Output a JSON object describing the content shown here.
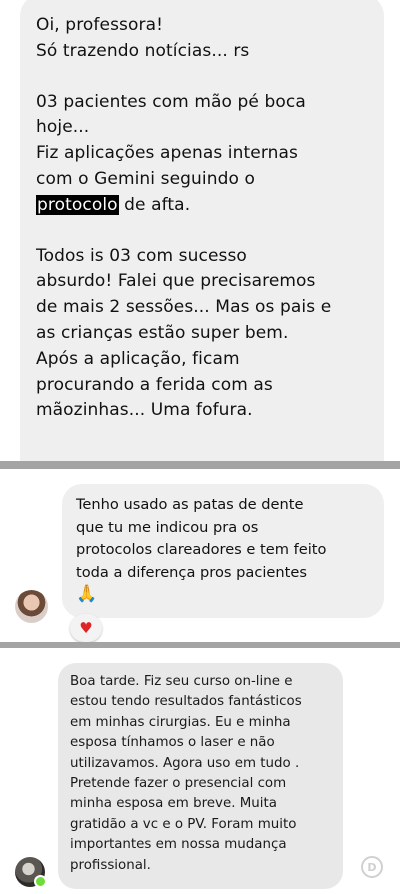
{
  "message_1": {
    "paragraph_1": [
      "Oi, professora!",
      "Só trazendo notícias... rs"
    ],
    "paragraph_2": {
      "lines": [
        "03 pacientes com mão pé boca",
        "hoje...",
        "Fiz aplicações apenas internas",
        "com o Gemini seguindo o"
      ],
      "highlighted_word": "protocolo",
      "after_highlight": " de afta."
    },
    "paragraph_3": [
      "Todos is 03 com sucesso",
      "absurdo! Falei que precisaremos",
      "de mais 2 sessões... Mas os pais e",
      "as crianças estão super bem.",
      "Após a aplicação, ficam",
      "procurando a ferida com as",
      "mãozinhas... Uma fofura."
    ]
  },
  "message_2": {
    "lines": [
      "Tenho usado as patas de dente",
      "que tu me indicou pra os",
      "protocolos clareadores e tem feito",
      "toda a diferença pros pacientes"
    ],
    "emoji": "🙏",
    "reaction": "♥",
    "avatar_icon": "woman-avatar-icon"
  },
  "message_3": {
    "lines": [
      "Boa tarde. Fiz seu curso on-line e",
      "estou tendo resultados fantásticos",
      "em minhas cirurgias. Eu e minha",
      "esposa tínhamos o laser e não",
      "utilizavamos. Agora uso em tudo .",
      "Pretende fazer o presencial com",
      "minha esposa em breve. Muita",
      "gratidão a vc e o PV. Foram muito",
      "importantes em nossa mudança",
      "profissional."
    ],
    "avatar_icon": "man-avatar-icon",
    "status_color": "#6fdc3a",
    "watermark_letter": "D"
  },
  "colors": {
    "bubble": "#efefef",
    "divider": "#a4a4a4",
    "highlight_bg": "#000000",
    "heart": "#e02424"
  }
}
